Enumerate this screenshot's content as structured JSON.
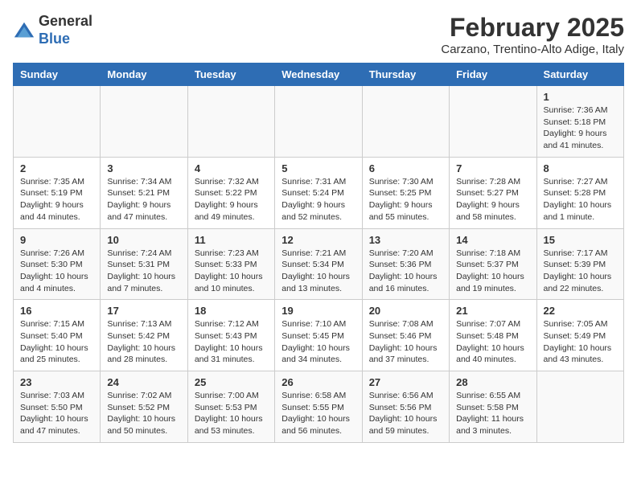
{
  "header": {
    "logo_general": "General",
    "logo_blue": "Blue",
    "month_year": "February 2025",
    "location": "Carzano, Trentino-Alto Adige, Italy"
  },
  "days_of_week": [
    "Sunday",
    "Monday",
    "Tuesday",
    "Wednesday",
    "Thursday",
    "Friday",
    "Saturday"
  ],
  "weeks": [
    [
      {
        "day": "",
        "info": ""
      },
      {
        "day": "",
        "info": ""
      },
      {
        "day": "",
        "info": ""
      },
      {
        "day": "",
        "info": ""
      },
      {
        "day": "",
        "info": ""
      },
      {
        "day": "",
        "info": ""
      },
      {
        "day": "1",
        "info": "Sunrise: 7:36 AM\nSunset: 5:18 PM\nDaylight: 9 hours and 41 minutes."
      }
    ],
    [
      {
        "day": "2",
        "info": "Sunrise: 7:35 AM\nSunset: 5:19 PM\nDaylight: 9 hours and 44 minutes."
      },
      {
        "day": "3",
        "info": "Sunrise: 7:34 AM\nSunset: 5:21 PM\nDaylight: 9 hours and 47 minutes."
      },
      {
        "day": "4",
        "info": "Sunrise: 7:32 AM\nSunset: 5:22 PM\nDaylight: 9 hours and 49 minutes."
      },
      {
        "day": "5",
        "info": "Sunrise: 7:31 AM\nSunset: 5:24 PM\nDaylight: 9 hours and 52 minutes."
      },
      {
        "day": "6",
        "info": "Sunrise: 7:30 AM\nSunset: 5:25 PM\nDaylight: 9 hours and 55 minutes."
      },
      {
        "day": "7",
        "info": "Sunrise: 7:28 AM\nSunset: 5:27 PM\nDaylight: 9 hours and 58 minutes."
      },
      {
        "day": "8",
        "info": "Sunrise: 7:27 AM\nSunset: 5:28 PM\nDaylight: 10 hours and 1 minute."
      }
    ],
    [
      {
        "day": "9",
        "info": "Sunrise: 7:26 AM\nSunset: 5:30 PM\nDaylight: 10 hours and 4 minutes."
      },
      {
        "day": "10",
        "info": "Sunrise: 7:24 AM\nSunset: 5:31 PM\nDaylight: 10 hours and 7 minutes."
      },
      {
        "day": "11",
        "info": "Sunrise: 7:23 AM\nSunset: 5:33 PM\nDaylight: 10 hours and 10 minutes."
      },
      {
        "day": "12",
        "info": "Sunrise: 7:21 AM\nSunset: 5:34 PM\nDaylight: 10 hours and 13 minutes."
      },
      {
        "day": "13",
        "info": "Sunrise: 7:20 AM\nSunset: 5:36 PM\nDaylight: 10 hours and 16 minutes."
      },
      {
        "day": "14",
        "info": "Sunrise: 7:18 AM\nSunset: 5:37 PM\nDaylight: 10 hours and 19 minutes."
      },
      {
        "day": "15",
        "info": "Sunrise: 7:17 AM\nSunset: 5:39 PM\nDaylight: 10 hours and 22 minutes."
      }
    ],
    [
      {
        "day": "16",
        "info": "Sunrise: 7:15 AM\nSunset: 5:40 PM\nDaylight: 10 hours and 25 minutes."
      },
      {
        "day": "17",
        "info": "Sunrise: 7:13 AM\nSunset: 5:42 PM\nDaylight: 10 hours and 28 minutes."
      },
      {
        "day": "18",
        "info": "Sunrise: 7:12 AM\nSunset: 5:43 PM\nDaylight: 10 hours and 31 minutes."
      },
      {
        "day": "19",
        "info": "Sunrise: 7:10 AM\nSunset: 5:45 PM\nDaylight: 10 hours and 34 minutes."
      },
      {
        "day": "20",
        "info": "Sunrise: 7:08 AM\nSunset: 5:46 PM\nDaylight: 10 hours and 37 minutes."
      },
      {
        "day": "21",
        "info": "Sunrise: 7:07 AM\nSunset: 5:48 PM\nDaylight: 10 hours and 40 minutes."
      },
      {
        "day": "22",
        "info": "Sunrise: 7:05 AM\nSunset: 5:49 PM\nDaylight: 10 hours and 43 minutes."
      }
    ],
    [
      {
        "day": "23",
        "info": "Sunrise: 7:03 AM\nSunset: 5:50 PM\nDaylight: 10 hours and 47 minutes."
      },
      {
        "day": "24",
        "info": "Sunrise: 7:02 AM\nSunset: 5:52 PM\nDaylight: 10 hours and 50 minutes."
      },
      {
        "day": "25",
        "info": "Sunrise: 7:00 AM\nSunset: 5:53 PM\nDaylight: 10 hours and 53 minutes."
      },
      {
        "day": "26",
        "info": "Sunrise: 6:58 AM\nSunset: 5:55 PM\nDaylight: 10 hours and 56 minutes."
      },
      {
        "day": "27",
        "info": "Sunrise: 6:56 AM\nSunset: 5:56 PM\nDaylight: 10 hours and 59 minutes."
      },
      {
        "day": "28",
        "info": "Sunrise: 6:55 AM\nSunset: 5:58 PM\nDaylight: 11 hours and 3 minutes."
      },
      {
        "day": "",
        "info": ""
      }
    ]
  ]
}
